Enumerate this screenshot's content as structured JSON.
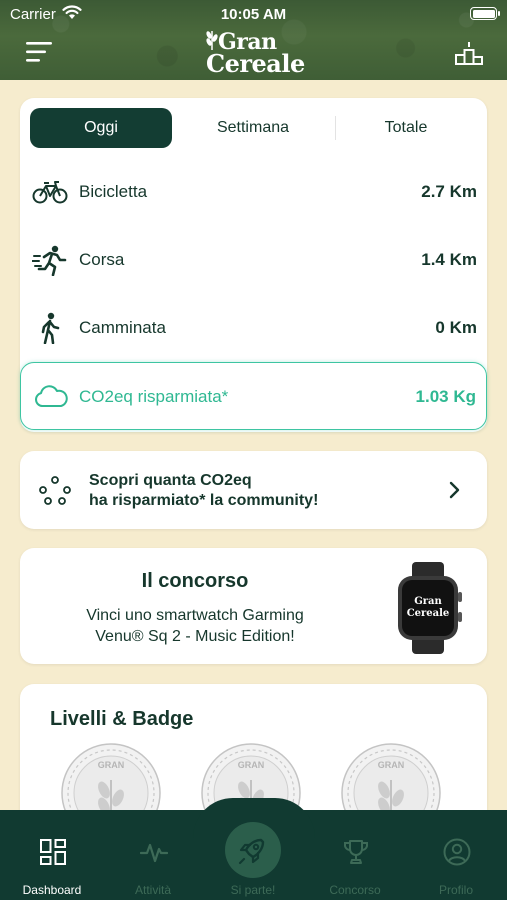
{
  "status_bar": {
    "carrier": "Carrier",
    "time": "10:05 AM"
  },
  "header": {
    "logo_line1": "Gran",
    "logo_line2": "Cereale"
  },
  "tabs": [
    {
      "label": "Oggi",
      "active": true
    },
    {
      "label": "Settimana",
      "active": false
    },
    {
      "label": "Totale",
      "active": false
    }
  ],
  "stats": [
    {
      "label": "Bicicletta",
      "value": "2.7 Km",
      "icon": "bicycle-icon"
    },
    {
      "label": "Corsa",
      "value": "1.4 Km",
      "icon": "running-icon"
    },
    {
      "label": "Camminata",
      "value": "0 Km",
      "icon": "walking-icon"
    }
  ],
  "co2": {
    "label": "CO2eq risparmiata*",
    "value": "1.03 Kg",
    "icon": "cloud-icon"
  },
  "community": {
    "line1": "Scopri quanta CO2eq",
    "line2": "ha risparmiato* la community!"
  },
  "contest": {
    "title": "Il concorso",
    "line1": "Vinci uno smartwatch Garming",
    "line2": "Venu® Sq 2 - Music Edition!",
    "watch_brand_line1": "Gran",
    "watch_brand_line2": "Cereale"
  },
  "badges": {
    "title": "Livelli & Badge",
    "badge_text": "GRAN"
  },
  "nav": {
    "dashboard": "Dashboard",
    "attivita": "Attività",
    "si_parte": "Si parte!",
    "concorso": "Concorso",
    "profilo": "Profilo"
  },
  "colors": {
    "primary": "#133d33",
    "accent": "#2fb892",
    "background": "#f6ecce"
  }
}
